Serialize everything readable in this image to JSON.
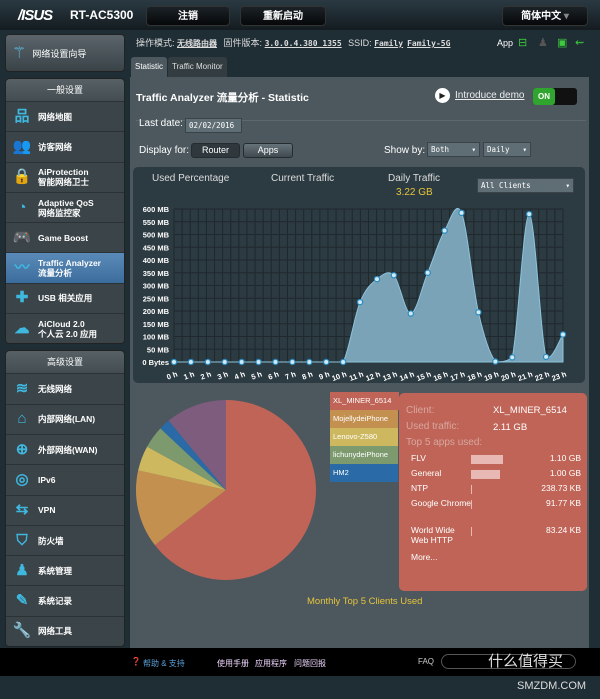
{
  "header": {
    "logo": "/ISUS",
    "model": "RT-AC5300",
    "logout": "注销",
    "reboot": "重新启动",
    "language": "简体中文"
  },
  "info": {
    "mode_label": "操作模式:",
    "mode": "无线路由器",
    "fw_label": "固件版本:",
    "fw": "3.0.0.4.380_1355",
    "ssid_label": "SSID:",
    "ssid1": "Family",
    "ssid2": "Family-5G",
    "app": "App"
  },
  "sidebar": {
    "quick_setup": "网络设置向导",
    "general_title": "一般设置",
    "general": [
      {
        "l1": "网络地图",
        "icon": "network-map-icon",
        "g": "品"
      },
      {
        "l1": "访客网络",
        "icon": "guest-network-icon",
        "g": "👥"
      },
      {
        "l1": "AiProtection",
        "l2": "智能网络卫士",
        "icon": "lock-icon",
        "g": "🔒"
      },
      {
        "l1": "Adaptive QoS",
        "l2": "网络监控家",
        "icon": "speedometer-icon",
        "g": "◔"
      },
      {
        "l1": "Game Boost",
        "icon": "gamepad-icon",
        "g": "🎮"
      },
      {
        "l1": "Traffic Analyzer",
        "l2": "流量分析",
        "icon": "traffic-icon",
        "g": "〰"
      },
      {
        "l1": "USB 相关应用",
        "icon": "puzzle-icon",
        "g": "✚"
      },
      {
        "l1": "AiCloud 2.0",
        "l2": "个人云 2.0 应用",
        "icon": "cloud-icon",
        "g": "☁"
      }
    ],
    "advanced_title": "高级设置",
    "advanced": [
      {
        "l1": "无线网络",
        "icon": "wifi-icon",
        "g": "≋"
      },
      {
        "l1": "内部网络(LAN)",
        "icon": "home-icon",
        "g": "⌂"
      },
      {
        "l1": "外部网络(WAN)",
        "icon": "globe-icon",
        "g": "⊕"
      },
      {
        "l1": "IPv6",
        "icon": "ipv6-icon",
        "g": "◎"
      },
      {
        "l1": "VPN",
        "icon": "vpn-icon",
        "g": "⇆"
      },
      {
        "l1": "防火墙",
        "icon": "shield-icon",
        "g": "⛉"
      },
      {
        "l1": "系统管理",
        "icon": "admin-icon",
        "g": "♟"
      },
      {
        "l1": "系统记录",
        "icon": "log-icon",
        "g": "✎"
      },
      {
        "l1": "网络工具",
        "icon": "wrench-icon",
        "g": "🔧"
      }
    ]
  },
  "tabs": [
    {
      "label": "Statistic"
    },
    {
      "label": "Traffic Monitor"
    }
  ],
  "main": {
    "title": "Traffic Analyzer 流量分析 - Statistic",
    "demo": "Introduce demo",
    "toggle": "ON",
    "last_date_label": "Last date:",
    "last_date": "02/02/2016",
    "display_for": "Display for:",
    "router": "Router",
    "apps": "Apps",
    "show_by": "Show by:",
    "show_sel1": "Both",
    "show_sel2": "Daily",
    "used_pct": "Used Percentage",
    "current": "Current Traffic",
    "daily": "Daily Traffic",
    "daily_value": "3.22 GB",
    "clients_sel": "All Clients",
    "monthly_caption": "Monthly Top 5 Clients Used"
  },
  "chart_data": [
    {
      "type": "area",
      "x": [
        "0 h",
        "1 h",
        "2 h",
        "3 h",
        "4 h",
        "5 h",
        "6 h",
        "7 h",
        "8 h",
        "9 h",
        "10 h",
        "11 h",
        "12 h",
        "13 h",
        "14 h",
        "15 h",
        "16 h",
        "17 h",
        "18 h",
        "19 h",
        "20 h",
        "21 h",
        "22 h",
        "23 h"
      ],
      "values_mb": [
        0,
        0,
        0,
        0,
        0,
        0,
        0,
        0,
        0,
        0,
        0,
        235,
        325,
        340,
        190,
        350,
        515,
        585,
        195,
        2,
        18,
        580,
        20,
        108
      ],
      "yticks": [
        "0 Bytes",
        "50 MB",
        "100 MB",
        "150 MB",
        "200 MB",
        "250 MB",
        "300 MB",
        "350 MB",
        "400 MB",
        "450 MB",
        "500 MB",
        "550 MB",
        "600 MB"
      ],
      "ylim": [
        0,
        600
      ],
      "grid": true,
      "color": "#7aa3b8"
    },
    {
      "type": "pie",
      "labels": [
        "XL_MINER_6514",
        "MojellydeiPhone",
        "Lenovo-Z580",
        "lichunydeiPhone",
        "HM2",
        ""
      ],
      "values": [
        64.5,
        14,
        4.5,
        4,
        2,
        11
      ],
      "colors": [
        "#bf6457",
        "#c49050",
        "#cdb860",
        "#7c9a6e",
        "#2a6aa6",
        "#7e5c7e"
      ],
      "legend": "right"
    }
  ],
  "card": {
    "client_label": "Client:",
    "client": "XL_MINER_6514",
    "used_label": "Used traffic:",
    "used": "2.11 GB",
    "top5": "Top 5 apps used:",
    "more": "More...",
    "apps": [
      {
        "name": "FLV",
        "value": "1.10 GB",
        "frac": 1.0
      },
      {
        "name": "General",
        "value": "1.00 GB",
        "frac": 0.91
      },
      {
        "name": "NTP",
        "value": "238.73 KB",
        "frac": 0
      },
      {
        "name": "Google Chrome",
        "value": "91.77 KB",
        "frac": 0
      },
      {
        "name": "World Wide Web HTTP",
        "value": "83.24 KB",
        "frac": 0
      }
    ]
  },
  "footer": {
    "help": "帮助 & 支持",
    "manual": "使用手册",
    "app": "应用程序",
    "feedback": "问题回报",
    "faq": "FAQ",
    "watermark": "什么值得买",
    "watermark2": "SMZDM.COM"
  }
}
